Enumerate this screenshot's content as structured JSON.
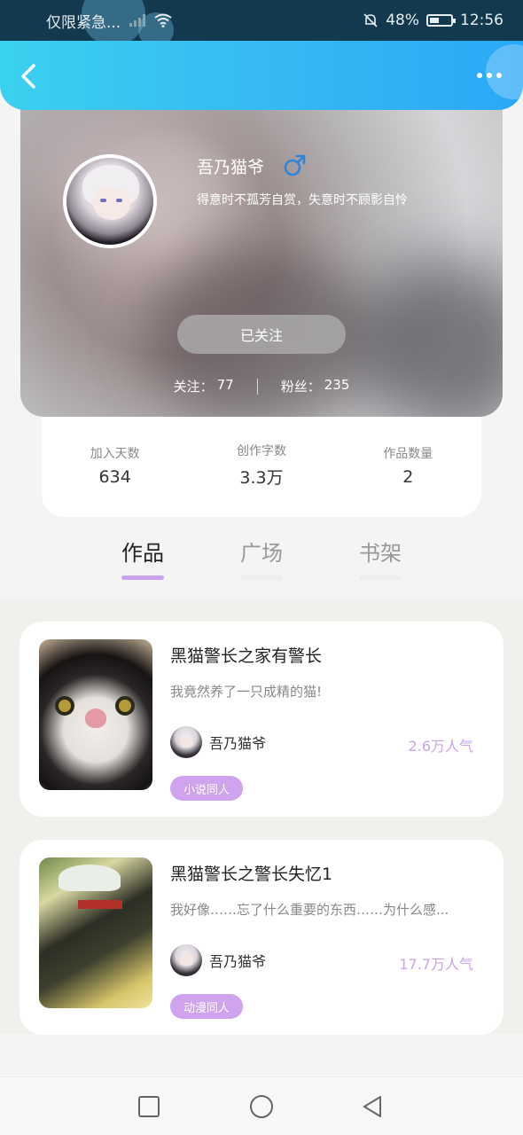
{
  "status_bar": {
    "carrier_text": "仅限紧急...",
    "battery_percent": "48%",
    "time": "12:56"
  },
  "profile": {
    "nickname": "吾乃猫爷",
    "gender_icon": "male-icon",
    "bio": "得意时不孤芳自赏，失意时不顾影自怜",
    "follow_button_label": "已关注",
    "following_label": "关注：",
    "following_count": "77",
    "fans_label": "粉丝：",
    "fans_count": "235"
  },
  "stats": [
    {
      "label": "加入天数",
      "value": "634"
    },
    {
      "label": "创作字数",
      "value": "3.3万"
    },
    {
      "label": "作品数量",
      "value": "2"
    }
  ],
  "tabs": [
    {
      "label": "作品",
      "active": true
    },
    {
      "label": "广场",
      "active": false
    },
    {
      "label": "书架",
      "active": false
    }
  ],
  "works": [
    {
      "title": "黑猫警长之家有警长",
      "description": "我竟然养了一只成精的猫!",
      "author": "吾乃猫爷",
      "popularity": "2.6万人气",
      "tag": "小说同人"
    },
    {
      "title": "黑猫警长之警长失忆1",
      "description": "我好像……忘了什么重要的东西……为什么感...",
      "author": "吾乃猫爷",
      "popularity": "17.7万人气",
      "tag": "动漫同人"
    }
  ],
  "colors": {
    "header_gradient_start": "#3ad1ef",
    "header_gradient_end": "#2aa8f7",
    "accent_purple": "#c9a3ee",
    "male_blue": "#2f86d8"
  }
}
